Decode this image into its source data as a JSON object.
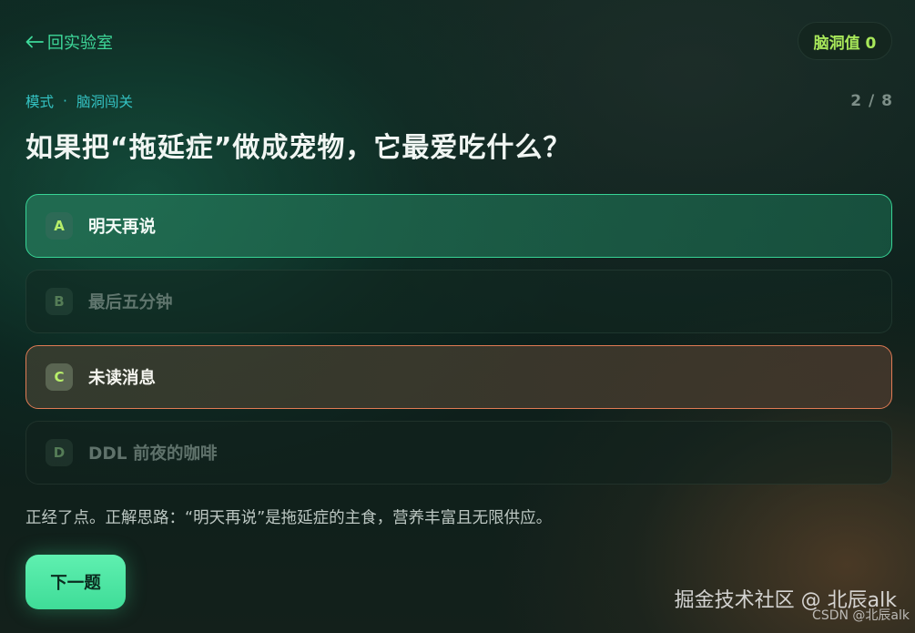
{
  "header": {
    "back_arrow": "←",
    "back_label": "回实验室",
    "score_label": "脑洞值 0"
  },
  "quiz": {
    "mode": "模式",
    "mode_separator": "·",
    "mode_name": "脑洞闯关",
    "progress": "2 / 8",
    "question": "如果把“拖延症”做成宠物，它最爱吃什么？",
    "options": [
      {
        "letter": "A",
        "text": "明天再说",
        "state": "correct"
      },
      {
        "letter": "B",
        "text": "最后五分钟",
        "state": "dimmed"
      },
      {
        "letter": "C",
        "text": "未读消息",
        "state": "selected-wrong"
      },
      {
        "letter": "D",
        "text": "DDL 前夜的咖啡",
        "state": "dimmed"
      }
    ],
    "explanation": "正经了点。正解思路：“明天再说”是拖延症的主食，营养丰富且无限供应。",
    "next_label": "下一题"
  },
  "watermark": {
    "main": "掘金技术社区 @ 北辰alk",
    "small": "CSDN @北辰alk"
  },
  "colors": {
    "accent_green": "#3ed99a",
    "score_green": "#a8e85a",
    "mode_cyan": "#34c3c4",
    "correct_border": "#37d495",
    "wrong_border": "#e07b54"
  }
}
